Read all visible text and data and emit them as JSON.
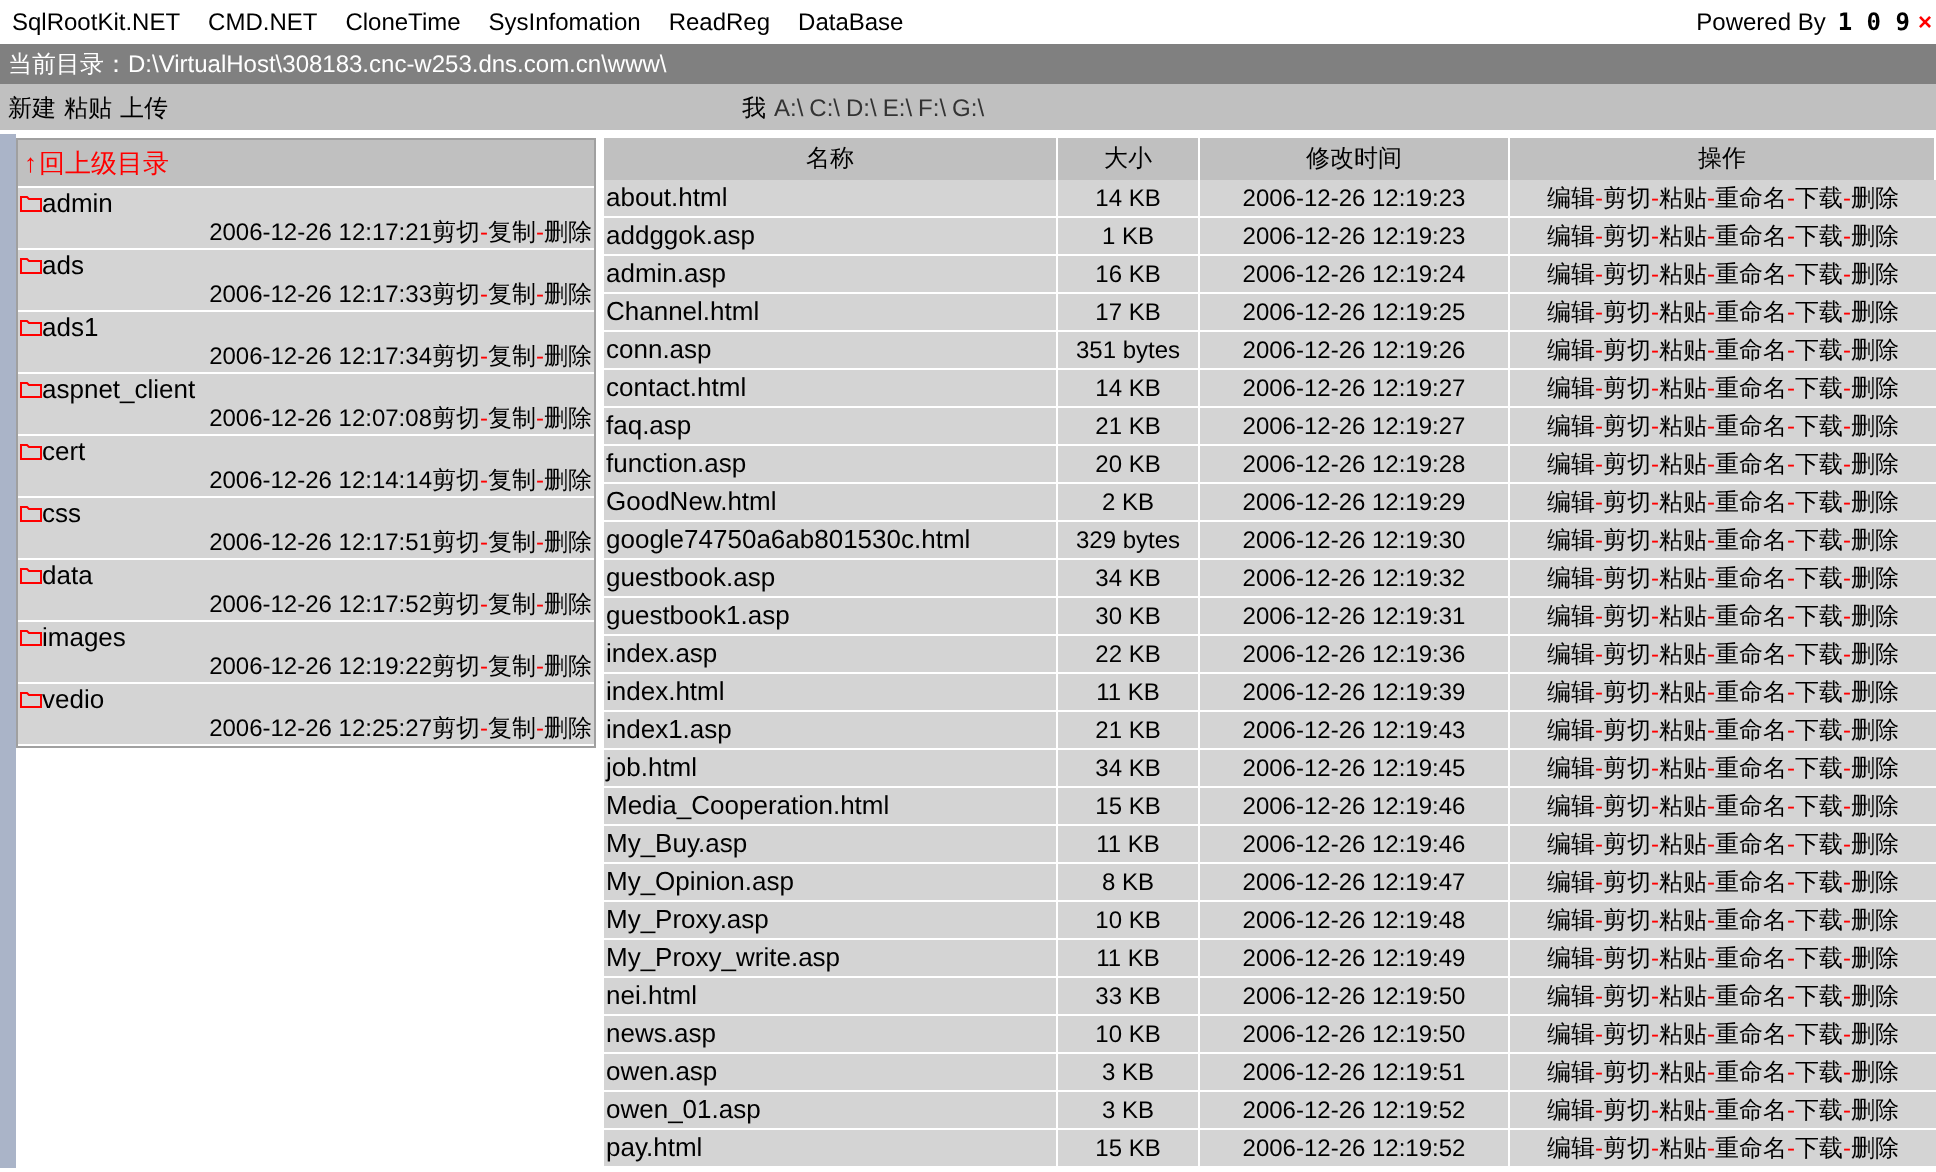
{
  "nav": {
    "items": [
      "SqlRootKit.NET",
      "CMD.NET",
      "CloneTime",
      "SysInfomation",
      "ReadReg",
      "DataBase"
    ],
    "powered_by": "Powered By",
    "version": "1 0 9",
    "close": "×"
  },
  "path_bar": {
    "label": "当前目录：",
    "path": "D:\\VirtualHost\\308183.cnc-w253.dns.com.cn\\www\\"
  },
  "toolbar": {
    "actions": [
      "新建",
      "粘贴",
      "上传"
    ],
    "drive_label": "我",
    "drives": [
      "A:\\",
      "C:\\",
      "D:\\",
      "E:\\",
      "F:\\",
      "G:\\"
    ]
  },
  "folders": {
    "up": "回上级目录",
    "up_icon": "↑",
    "items": [
      {
        "name": "admin",
        "modified": "2006-12-26 12:17:21",
        "actions": [
          "剪切",
          "-",
          "复制",
          "-",
          "删除"
        ]
      },
      {
        "name": "ads",
        "modified": "2006-12-26 12:17:33",
        "actions": [
          "剪切",
          "-",
          "复制",
          "-",
          "删除"
        ]
      },
      {
        "name": "ads1",
        "modified": "2006-12-26 12:17:34",
        "actions": [
          "剪切",
          "-",
          "复制",
          "-",
          "删除"
        ]
      },
      {
        "name": "aspnet_client",
        "modified": "2006-12-26 12:07:08",
        "actions": [
          "剪切",
          "-",
          "复制",
          "-",
          "删除"
        ]
      },
      {
        "name": "cert",
        "modified": "2006-12-26 12:14:14",
        "actions": [
          "剪切",
          "-",
          "复制",
          "-",
          "删除"
        ]
      },
      {
        "name": "css",
        "modified": "2006-12-26 12:17:51",
        "actions": [
          "剪切",
          "-",
          "复制",
          "-",
          "删除"
        ]
      },
      {
        "name": "data",
        "modified": "2006-12-26 12:17:52",
        "actions": [
          "剪切",
          "-",
          "复制",
          "-",
          "删除"
        ]
      },
      {
        "name": "images",
        "modified": "2006-12-26 12:19:22",
        "actions": [
          "剪切",
          "-",
          "复制",
          "-",
          "删除"
        ]
      },
      {
        "name": "vedio",
        "modified": "2006-12-26 12:25:27",
        "actions": [
          "剪切",
          "-",
          "复制",
          "-",
          "删除"
        ]
      }
    ]
  },
  "table": {
    "columns": [
      "名称",
      "大小",
      "修改时间",
      "操作"
    ],
    "rows": [
      {
        "name": "about.html",
        "size": "14 KB",
        "modified": "2006-12-26 12:19:23",
        "actions": [
          "编辑",
          "-",
          "剪切",
          "-",
          "粘贴",
          "-",
          "重命名",
          "-",
          "下载",
          "-",
          "删除"
        ]
      },
      {
        "name": "addggok.asp",
        "size": "1 KB",
        "modified": "2006-12-26 12:19:23",
        "actions": [
          "编辑",
          "-",
          "剪切",
          "-",
          "粘贴",
          "-",
          "重命名",
          "-",
          "下载",
          "-",
          "删除"
        ]
      },
      {
        "name": "admin.asp",
        "size": "16 KB",
        "modified": "2006-12-26 12:19:24",
        "actions": [
          "编辑",
          "-",
          "剪切",
          "-",
          "粘贴",
          "-",
          "重命名",
          "-",
          "下载",
          "-",
          "删除"
        ]
      },
      {
        "name": "Channel.html",
        "size": "17 KB",
        "modified": "2006-12-26 12:19:25",
        "actions": [
          "编辑",
          "-",
          "剪切",
          "-",
          "粘贴",
          "-",
          "重命名",
          "-",
          "下载",
          "-",
          "删除"
        ]
      },
      {
        "name": "conn.asp",
        "size": "351 bytes",
        "modified": "2006-12-26 12:19:26",
        "actions": [
          "编辑",
          "-",
          "剪切",
          "-",
          "粘贴",
          "-",
          "重命名",
          "-",
          "下载",
          "-",
          "删除"
        ]
      },
      {
        "name": "contact.html",
        "size": "14 KB",
        "modified": "2006-12-26 12:19:27",
        "actions": [
          "编辑",
          "-",
          "剪切",
          "-",
          "粘贴",
          "-",
          "重命名",
          "-",
          "下载",
          "-",
          "删除"
        ]
      },
      {
        "name": "faq.asp",
        "size": "21 KB",
        "modified": "2006-12-26 12:19:27",
        "actions": [
          "编辑",
          "-",
          "剪切",
          "-",
          "粘贴",
          "-",
          "重命名",
          "-",
          "下载",
          "-",
          "删除"
        ]
      },
      {
        "name": "function.asp",
        "size": "20 KB",
        "modified": "2006-12-26 12:19:28",
        "actions": [
          "编辑",
          "-",
          "剪切",
          "-",
          "粘贴",
          "-",
          "重命名",
          "-",
          "下载",
          "-",
          "删除"
        ]
      },
      {
        "name": "GoodNew.html",
        "size": "2 KB",
        "modified": "2006-12-26 12:19:29",
        "actions": [
          "编辑",
          "-",
          "剪切",
          "-",
          "粘贴",
          "-",
          "重命名",
          "-",
          "下载",
          "-",
          "删除"
        ]
      },
      {
        "name": "google74750a6ab801530c.html",
        "size": "329 bytes",
        "modified": "2006-12-26 12:19:30",
        "actions": [
          "编辑",
          "-",
          "剪切",
          "-",
          "粘贴",
          "-",
          "重命名",
          "-",
          "下载",
          "-",
          "删除"
        ]
      },
      {
        "name": "guestbook.asp",
        "size": "34 KB",
        "modified": "2006-12-26 12:19:32",
        "actions": [
          "编辑",
          "-",
          "剪切",
          "-",
          "粘贴",
          "-",
          "重命名",
          "-",
          "下载",
          "-",
          "删除"
        ]
      },
      {
        "name": "guestbook1.asp",
        "size": "30 KB",
        "modified": "2006-12-26 12:19:31",
        "actions": [
          "编辑",
          "-",
          "剪切",
          "-",
          "粘贴",
          "-",
          "重命名",
          "-",
          "下载",
          "-",
          "删除"
        ]
      },
      {
        "name": "index.asp",
        "size": "22 KB",
        "modified": "2006-12-26 12:19:36",
        "actions": [
          "编辑",
          "-",
          "剪切",
          "-",
          "粘贴",
          "-",
          "重命名",
          "-",
          "下载",
          "-",
          "删除"
        ]
      },
      {
        "name": "index.html",
        "size": "11 KB",
        "modified": "2006-12-26 12:19:39",
        "actions": [
          "编辑",
          "-",
          "剪切",
          "-",
          "粘贴",
          "-",
          "重命名",
          "-",
          "下载",
          "-",
          "删除"
        ]
      },
      {
        "name": "index1.asp",
        "size": "21 KB",
        "modified": "2006-12-26 12:19:43",
        "actions": [
          "编辑",
          "-",
          "剪切",
          "-",
          "粘贴",
          "-",
          "重命名",
          "-",
          "下载",
          "-",
          "删除"
        ]
      },
      {
        "name": "job.html",
        "size": "34 KB",
        "modified": "2006-12-26 12:19:45",
        "actions": [
          "编辑",
          "-",
          "剪切",
          "-",
          "粘贴",
          "-",
          "重命名",
          "-",
          "下载",
          "-",
          "删除"
        ]
      },
      {
        "name": "Media_Cooperation.html",
        "size": "15 KB",
        "modified": "2006-12-26 12:19:46",
        "actions": [
          "编辑",
          "-",
          "剪切",
          "-",
          "粘贴",
          "-",
          "重命名",
          "-",
          "下载",
          "-",
          "删除"
        ]
      },
      {
        "name": "My_Buy.asp",
        "size": "11 KB",
        "modified": "2006-12-26 12:19:46",
        "actions": [
          "编辑",
          "-",
          "剪切",
          "-",
          "粘贴",
          "-",
          "重命名",
          "-",
          "下载",
          "-",
          "删除"
        ]
      },
      {
        "name": "My_Opinion.asp",
        "size": "8 KB",
        "modified": "2006-12-26 12:19:47",
        "actions": [
          "编辑",
          "-",
          "剪切",
          "-",
          "粘贴",
          "-",
          "重命名",
          "-",
          "下载",
          "-",
          "删除"
        ]
      },
      {
        "name": "My_Proxy.asp",
        "size": "10 KB",
        "modified": "2006-12-26 12:19:48",
        "actions": [
          "编辑",
          "-",
          "剪切",
          "-",
          "粘贴",
          "-",
          "重命名",
          "-",
          "下载",
          "-",
          "删除"
        ]
      },
      {
        "name": "My_Proxy_write.asp",
        "size": "11 KB",
        "modified": "2006-12-26 12:19:49",
        "actions": [
          "编辑",
          "-",
          "剪切",
          "-",
          "粘贴",
          "-",
          "重命名",
          "-",
          "下载",
          "-",
          "删除"
        ]
      },
      {
        "name": "nei.html",
        "size": "33 KB",
        "modified": "2006-12-26 12:19:50",
        "actions": [
          "编辑",
          "-",
          "剪切",
          "-",
          "粘贴",
          "-",
          "重命名",
          "-",
          "下载",
          "-",
          "删除"
        ]
      },
      {
        "name": "news.asp",
        "size": "10 KB",
        "modified": "2006-12-26 12:19:50",
        "actions": [
          "编辑",
          "-",
          "剪切",
          "-",
          "粘贴",
          "-",
          "重命名",
          "-",
          "下载",
          "-",
          "删除"
        ]
      },
      {
        "name": "owen.asp",
        "size": "3 KB",
        "modified": "2006-12-26 12:19:51",
        "actions": [
          "编辑",
          "-",
          "剪切",
          "-",
          "粘贴",
          "-",
          "重命名",
          "-",
          "下载",
          "-",
          "删除"
        ]
      },
      {
        "name": "owen_01.asp",
        "size": "3 KB",
        "modified": "2006-12-26 12:19:52",
        "actions": [
          "编辑",
          "-",
          "剪切",
          "-",
          "粘贴",
          "-",
          "重命名",
          "-",
          "下载",
          "-",
          "删除"
        ]
      },
      {
        "name": "pay.html",
        "size": "15 KB",
        "modified": "2006-12-26 12:19:52",
        "actions": [
          "编辑",
          "-",
          "剪切",
          "-",
          "粘贴",
          "-",
          "重命名",
          "-",
          "下载",
          "-",
          "删除"
        ]
      }
    ]
  }
}
